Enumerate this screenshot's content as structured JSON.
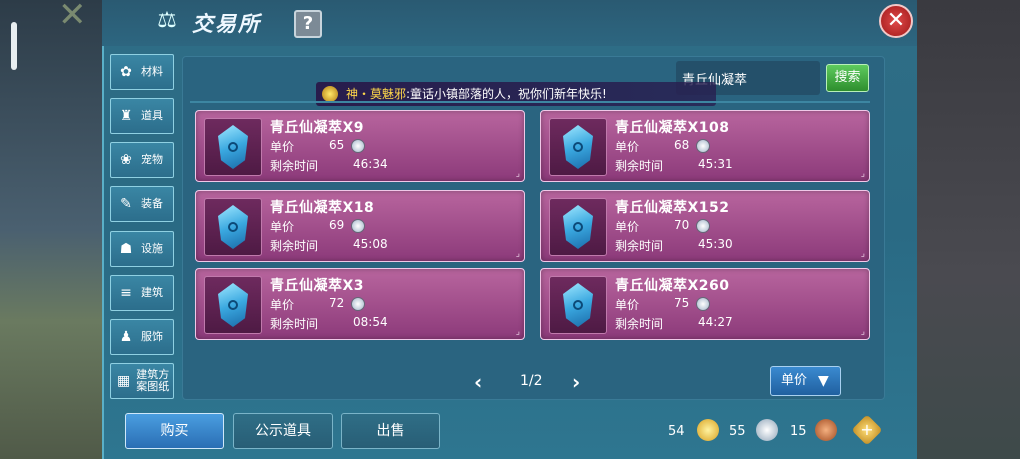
{
  "header": {
    "title": "交易所",
    "help": "?",
    "close": "✕"
  },
  "sidebar": [
    {
      "label": "材料",
      "icon": "materials-icon",
      "glyph": "✿"
    },
    {
      "label": "道具",
      "icon": "potion-icon",
      "glyph": "♜"
    },
    {
      "label": "宠物",
      "icon": "pawprint-icon",
      "glyph": "❀"
    },
    {
      "label": "装备",
      "icon": "sword-icon",
      "glyph": "✎"
    },
    {
      "label": "设施",
      "icon": "facility-icon",
      "glyph": "☗"
    },
    {
      "label": "建筑",
      "icon": "building-icon",
      "glyph": "≡"
    },
    {
      "label": "服饰",
      "icon": "clothing-icon",
      "glyph": "♟"
    },
    {
      "label": "建筑方案图纸",
      "icon": "blueprint-icon",
      "glyph": "▦"
    }
  ],
  "search": {
    "value": "青丘仙凝萃",
    "button": "搜索"
  },
  "broadcast": {
    "name": "神・莫魅邪",
    "text": ":童话小镇部落的人，祝你们新年快乐!"
  },
  "listings": [
    {
      "name": "青丘仙凝萃X9",
      "price_label": "单价",
      "price": "65",
      "time_label": "剩余时间",
      "time": "46:34"
    },
    {
      "name": "青丘仙凝萃X108",
      "price_label": "单价",
      "price": "68",
      "time_label": "剩余时间",
      "time": "45:31"
    },
    {
      "name": "青丘仙凝萃X18",
      "price_label": "单价",
      "price": "69",
      "time_label": "剩余时间",
      "time": "45:08"
    },
    {
      "name": "青丘仙凝萃X152",
      "price_label": "单价",
      "price": "70",
      "time_label": "剩余时间",
      "time": "45:30"
    },
    {
      "name": "青丘仙凝萃X3",
      "price_label": "单价",
      "price": "72",
      "time_label": "剩余时间",
      "time": "08:54"
    },
    {
      "name": "青丘仙凝萃X260",
      "price_label": "单价",
      "price": "75",
      "time_label": "剩余时间",
      "time": "44:27"
    }
  ],
  "pagination": {
    "page": "1/2",
    "prev": "‹",
    "next": "›"
  },
  "sort_button": "单价",
  "bottom": {
    "buy": "购买",
    "public": "公示道具",
    "sell": "出售"
  },
  "currency": {
    "gold": "54",
    "silver": "55",
    "copper": "15"
  },
  "colors": {
    "accent": "#2f6e86",
    "card": "#a04f8e",
    "buy": "#3a86d0"
  }
}
